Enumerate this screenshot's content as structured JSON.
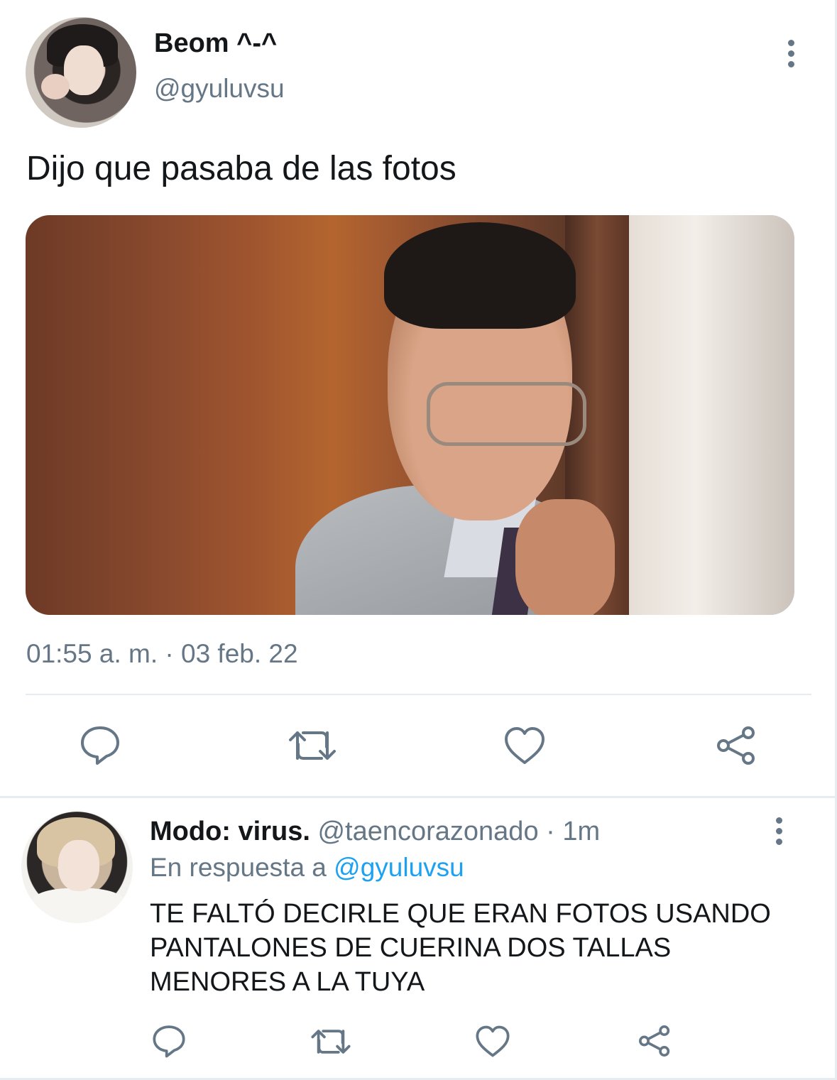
{
  "tweet": {
    "author_name": "Beom ^-^",
    "author_handle": "@gyuluvsu",
    "text": "Dijo que pasaba de las fotos",
    "timestamp": "01:55 a. m. · 03 feb. 22",
    "actions": [
      "reply-icon",
      "retweet-icon",
      "like-icon",
      "share-icon"
    ]
  },
  "reply": {
    "author_name": "Modo: virus.",
    "author_handle": "@taencorazonado",
    "separator": " · ",
    "time_ago": "1m",
    "in_reply_to_prefix": "En respuesta a ",
    "in_reply_to_handle": "@gyuluvsu",
    "text": "TE FALTÓ DECIRLE QUE ERAN FOTOS USANDO PANTALONES DE CUERINA DOS TALLAS MENORES A LA TUYA",
    "actions": [
      "reply-icon",
      "retweet-icon",
      "like-icon",
      "share-icon"
    ]
  },
  "colors": {
    "text": "#14171a",
    "muted": "#657786",
    "link": "#1da1f2",
    "divider": "#e6ecf0"
  }
}
